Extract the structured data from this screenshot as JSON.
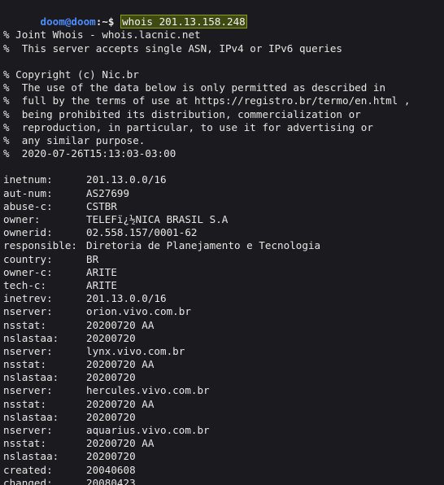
{
  "prompt": {
    "user_host": "doom@doom",
    "separator": ":~$",
    "command": "whois 201.13.158.248"
  },
  "header": [
    "% Joint Whois - whois.lacnic.net",
    "%  This server accepts single ASN, IPv4 or IPv6 queries",
    "% Copyright (c) Nic.br",
    "%  The use of the data below is only permitted as described in",
    "%  full by the terms of use at https://registro.br/termo/en.html ,",
    "%  being prohibited its distribution, commercialization or",
    "%  reproduction, in particular, to use it for advertising or",
    "%  any similar purpose.",
    "%  2020-07-26T15:13:03-03:00"
  ],
  "records": [
    {
      "key": "inetnum:",
      "value": "201.13.0.0/16"
    },
    {
      "key": "aut-num:",
      "value": "AS27699"
    },
    {
      "key": "abuse-c:",
      "value": "CSTBR"
    },
    {
      "key": "owner:",
      "value": "TELEFï¿½NICA BRASIL S.A"
    },
    {
      "key": "ownerid:",
      "value": "02.558.157/0001-62"
    },
    {
      "key": "responsible:",
      "value": "Diretoria de Planejamento e Tecnologia"
    },
    {
      "key": "country:",
      "value": "BR"
    },
    {
      "key": "owner-c:",
      "value": "ARITE"
    },
    {
      "key": "tech-c:",
      "value": "ARITE"
    },
    {
      "key": "inetrev:",
      "value": "201.13.0.0/16"
    },
    {
      "key": "nserver:",
      "value": "orion.vivo.com.br"
    },
    {
      "key": "nsstat:",
      "value": "20200720 AA"
    },
    {
      "key": "nslastaa:",
      "value": "20200720"
    },
    {
      "key": "nserver:",
      "value": "lynx.vivo.com.br"
    },
    {
      "key": "nsstat:",
      "value": "20200720 AA"
    },
    {
      "key": "nslastaa:",
      "value": "20200720"
    },
    {
      "key": "nserver:",
      "value": "hercules.vivo.com.br"
    },
    {
      "key": "nsstat:",
      "value": "20200720 AA"
    },
    {
      "key": "nslastaa:",
      "value": "20200720"
    },
    {
      "key": "nserver:",
      "value": "aquarius.vivo.com.br"
    },
    {
      "key": "nsstat:",
      "value": "20200720 AA"
    },
    {
      "key": "nslastaa:",
      "value": "20200720"
    },
    {
      "key": "created:",
      "value": "20040608"
    },
    {
      "key": "changed:",
      "value": "20080423"
    }
  ]
}
